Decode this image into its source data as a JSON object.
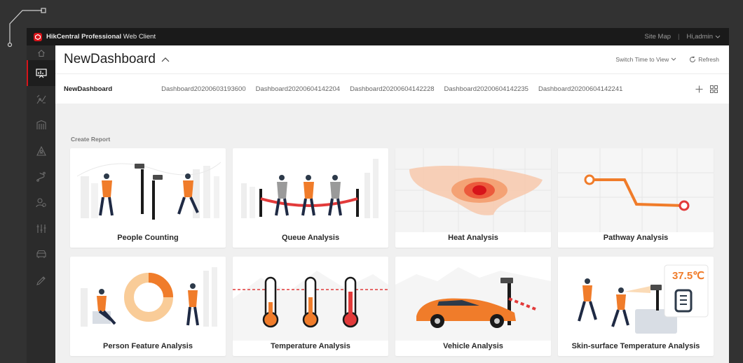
{
  "app": {
    "brand_bold": "HikCentral Professional",
    "brand_rest": " Web Client",
    "site_map": "Site Map",
    "separator": "|",
    "user": "Hi,admin"
  },
  "header": {
    "title": "NewDashboard",
    "switch_time": "Switch Time to View",
    "refresh": "Refresh"
  },
  "tabs": [
    "NewDashboard",
    "Dashboard20200603193600",
    "Dashboard20200604142204",
    "Dashboard20200604142228",
    "Dashboard20200604142235",
    "Dashboard20200604142241"
  ],
  "section_label": "Create Report",
  "cards": [
    {
      "label": "People Counting"
    },
    {
      "label": "Queue Analysis"
    },
    {
      "label": "Heat Analysis"
    },
    {
      "label": "Pathway Analysis"
    },
    {
      "label": "Person Feature Analysis"
    },
    {
      "label": "Temperature Analysis"
    },
    {
      "label": "Vehicle Analysis"
    },
    {
      "label": "Skin-surface Temperature Analysis"
    }
  ],
  "skin_temp_value": "37.5℃",
  "sidebar_icons": [
    "home-icon",
    "dashboard-icon",
    "intelligent-analysis-icon",
    "access-control-icon",
    "alarm-icon",
    "pathway-icon",
    "person-icon",
    "statistics-icon",
    "vehicle-icon",
    "maintenance-icon"
  ],
  "colors": {
    "accent": "#d7141a",
    "orange": "#f07c2a",
    "titlebar": "#1a1a1a",
    "sidebar": "#2b2b2b"
  }
}
